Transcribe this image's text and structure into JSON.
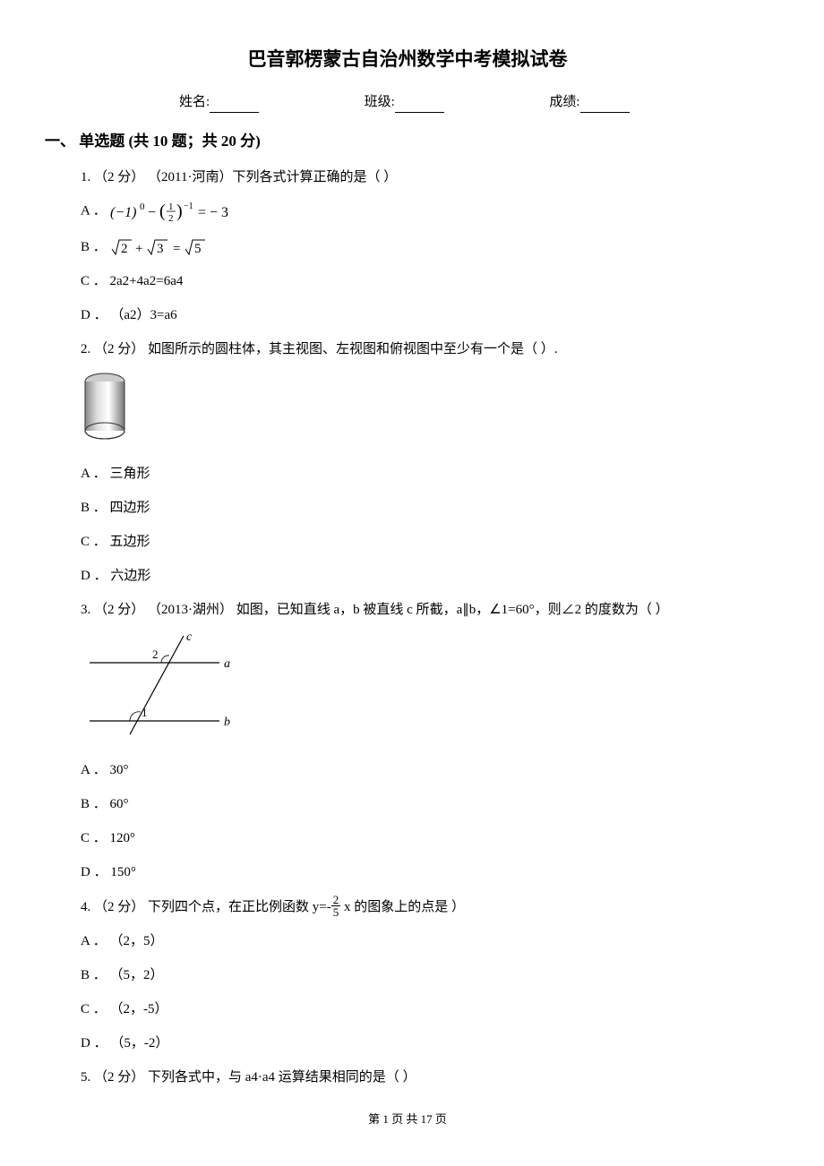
{
  "title": "巴音郭楞蒙古自治州数学中考模拟试卷",
  "info": {
    "name_label": "姓名:",
    "class_label": "班级:",
    "score_label": "成绩:"
  },
  "section1": {
    "header": "一、 单选题 (共 10 题；共 20 分)"
  },
  "q1": {
    "stem": "1.  （2 分） （2011·河南）下列各式计算正确的是（     ）",
    "optA_prefix": "A ．",
    "optA_math": "(−1)⁰ − (½)⁻¹ = −3",
    "optB_prefix": "B ．",
    "optB_math": "√2 + √3 = √5",
    "optC": "C ． 2a2+4a2=6a4",
    "optD": "D ． （a2）3=a6"
  },
  "q2": {
    "stem": "2.  （2 分）  如图所示的圆柱体，其主视图、左视图和俯视图中至少有一个是（     ）.",
    "optA": "A ． 三角形",
    "optB": "B ． 四边形",
    "optC": "C ． 五边形",
    "optD": "D ． 六边形"
  },
  "q3": {
    "stem": "3.  （2 分） （2013·湖州） 如图，已知直线 a，b 被直线 c 所截，a∥b，∠1=60°，则∠2 的度数为（     ）",
    "optA": "A ． 30°",
    "optB": "B ． 60°",
    "optC": "C ． 120°",
    "optD": "D ． 150°"
  },
  "q4": {
    "stem_pre": "4.  （2 分）  下列四个点，在正比例函数 y=-",
    "frac_num": "2",
    "frac_den": "5",
    "stem_post": " x 的图象上的点是      ）",
    "optA": "A ． （2，5）",
    "optB": "B ． （5，2）",
    "optC": "C ． （2，-5）",
    "optD": "D ． （5，-2）"
  },
  "q5": {
    "stem": "5.  （2 分）  下列各式中，与 a4·a4 运算结果相同的是（      ）"
  },
  "footer": "第 1 页 共 17 页"
}
